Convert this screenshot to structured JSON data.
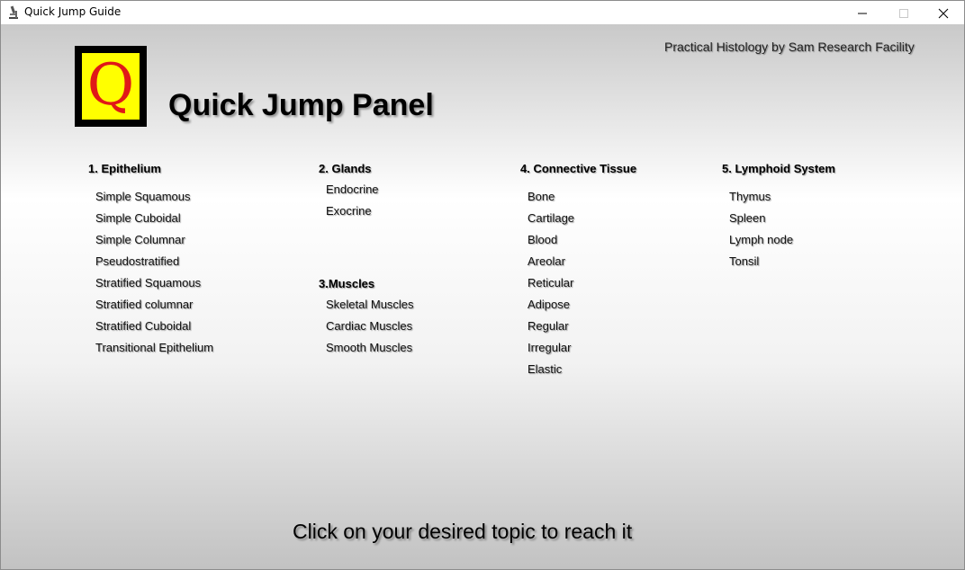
{
  "window": {
    "title": "Quick Jump Guide"
  },
  "header": {
    "logo_letter": "Q",
    "panel_title": "Quick Jump Panel",
    "credit": "Practical Histology by Sam Research Facility"
  },
  "sections": {
    "epithelium": {
      "heading": "1. Epithelium",
      "items": [
        "Simple Squamous",
        "Simple Cuboidal",
        "Simple Columnar",
        "Pseudostratified",
        "Stratified Squamous",
        "Stratified columnar",
        "Stratified Cuboidal",
        "Transitional Epithelium"
      ]
    },
    "glands": {
      "heading": "2. Glands",
      "items": [
        "Endocrine",
        "Exocrine"
      ]
    },
    "muscles": {
      "heading": "3.Muscles",
      "items": [
        "Skeletal Muscles",
        "Cardiac Muscles",
        "Smooth Muscles"
      ]
    },
    "connective": {
      "heading": "4. Connective Tissue",
      "items": [
        "Bone",
        "Cartilage",
        "Blood",
        "Areolar",
        "Reticular",
        "Adipose",
        "Regular",
        "Irregular",
        "Elastic"
      ]
    },
    "lymphoid": {
      "heading": "5. Lymphoid System",
      "items": [
        "Thymus",
        "Spleen",
        "Lymph node",
        "Tonsil"
      ]
    }
  },
  "footer": {
    "hint": "Click on your desired topic to reach it"
  },
  "colors": {
    "logo_background": "#ffff00",
    "logo_letter": "#e01818"
  }
}
